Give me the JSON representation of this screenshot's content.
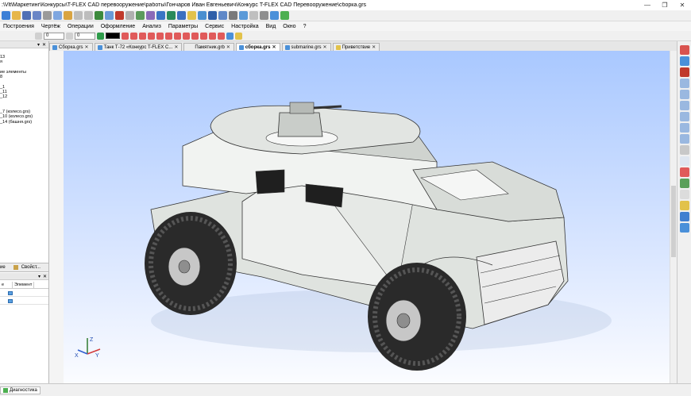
{
  "window": {
    "title": ":\\Vlt\\Маркетинг\\Конкурсы\\T-FLEX CAD перевооружение\\работы\\Гончаров Иван Евгеньевич\\Конкурс T-FLEX CAD Перевооружение\\сборка.grs",
    "controls": [
      "—",
      "❐",
      "✕"
    ]
  },
  "menu": [
    "Построения",
    "Чертёж",
    "Операции",
    "Оформление",
    "Анализ",
    "Параметры",
    "Сервис",
    "Настройка",
    "Вид",
    "Окно",
    "?"
  ],
  "toolbar2": {
    "layer_value": "0",
    "level_value": "0"
  },
  "panel": {
    "close_glyphs": [
      "▾",
      "✕"
    ],
    "tree": [
      "13",
      "я",
      "ие элементы",
      "8",
      "_1",
      "_11",
      "_12",
      "_7 (колесо.grs)",
      "_10 (колесо.grs)",
      "_14 (башня.grs)"
    ],
    "bottom_tabs": [
      "ие",
      "Свойст..."
    ],
    "diag_columns": [
      "е",
      "Элемент"
    ]
  },
  "document_tabs": [
    {
      "label": "Сборка.grs",
      "active": false
    },
    {
      "label": "Танк Т-72 «Конкурс T-FLEX С...",
      "active": false
    },
    {
      "label": "Памятник.grb",
      "active": false
    },
    {
      "label": "сборка.grs",
      "active": true
    },
    {
      "label": "submarine.grs",
      "active": false
    },
    {
      "label": "Приветствие",
      "active": false
    }
  ],
  "status": {
    "diagnostics_tab": "Диагностика"
  },
  "axes": {
    "x": "X",
    "y": "Y",
    "z": "Z"
  },
  "colors": {
    "viewport_top": "#a9c8ff",
    "viewport_bottom": "#fbfcff",
    "tab_icon": "#4a90d9"
  }
}
